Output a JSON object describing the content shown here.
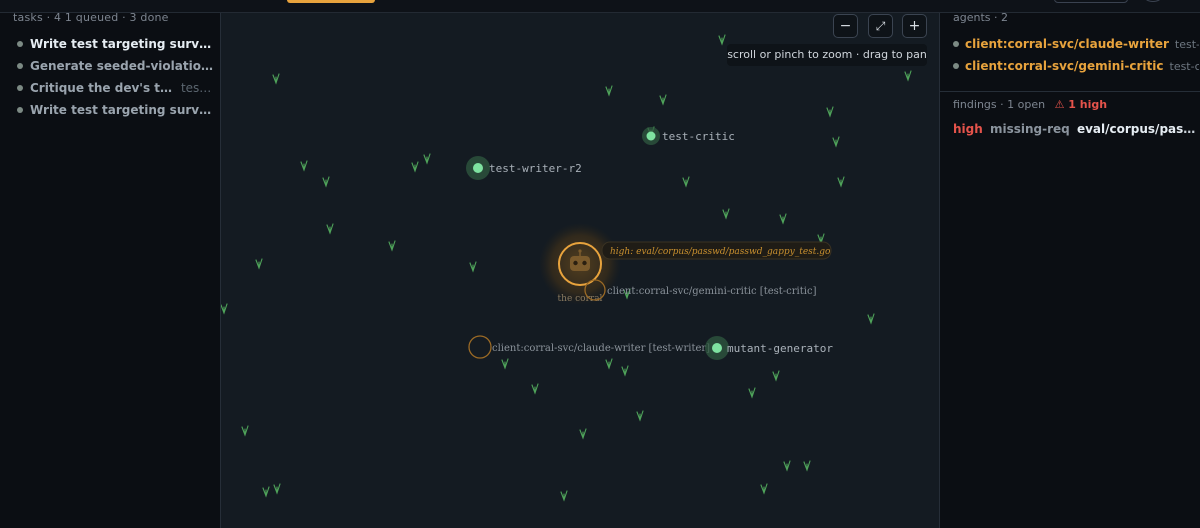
{
  "tasks": {
    "header": "tasks · 4   1 queued · 3 done",
    "items": [
      {
        "title": "Write test targeting surviv...",
        "subtitle": "",
        "active": true
      },
      {
        "title": "Generate seeded-violation ...",
        "subtitle": "",
        "active": false
      },
      {
        "title": "Critique the dev's tests",
        "subtitle": "test...",
        "active": false
      },
      {
        "title": "Write test targeting surviv...",
        "subtitle": "",
        "active": false
      }
    ]
  },
  "graph": {
    "zoom_out": "−",
    "fit": "⤢",
    "zoom_in": "+",
    "hint": "scroll or pinch to zoom · drag to pan",
    "hub_label": "the corral",
    "hub_icon": "robot-face-icon",
    "hub_callout": "high: eval/corpus/passwd/passwd_gappy_test.go",
    "nodes": [
      {
        "id": "test-critic",
        "label": "test-critic"
      },
      {
        "id": "test-writer-r2",
        "label": "test-writer-r2"
      },
      {
        "id": "mutant-generator",
        "label": "mutant-generator"
      }
    ],
    "clients": [
      {
        "id": "gemini",
        "label": "client:corral-svc/gemini-critic [test-critic]"
      },
      {
        "id": "claude",
        "label": "client:corral-svc/claude-writer [test-writer]"
      }
    ],
    "colors": {
      "node": "#7ee2a0",
      "client": "#e8a33d",
      "grass": "#4fa35a",
      "background": "#141b22"
    }
  },
  "agents": {
    "header": "agents · 2",
    "items": [
      {
        "name": "client:corral-svc/claude-writer",
        "role": "test-wr"
      },
      {
        "name": "client:corral-svc/gemini-critic",
        "role": "test-crit"
      }
    ]
  },
  "findings": {
    "header": "findings · 1 open",
    "high_badge": "⚠ 1 high",
    "item": {
      "severity": "high",
      "rule": "missing-req",
      "path": "eval/corpus/passwd..."
    }
  }
}
